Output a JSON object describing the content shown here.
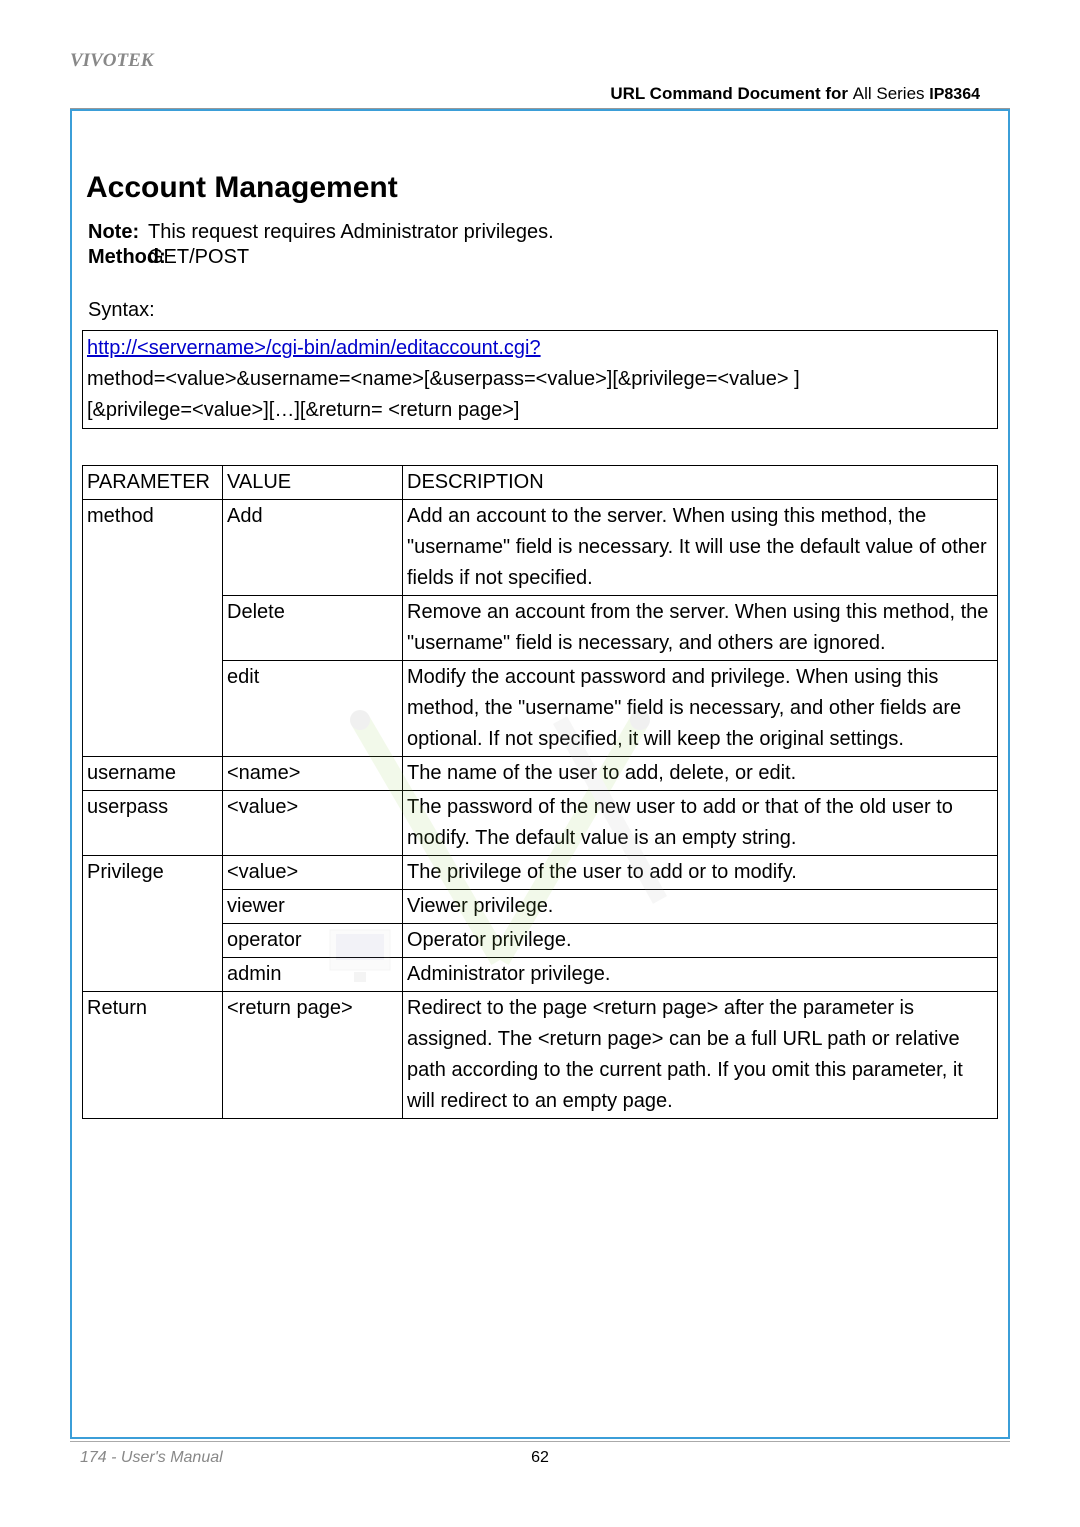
{
  "header": {
    "brand": "VIVOTEK",
    "doc_title_bold": "URL Command Document for ",
    "doc_title_series": "  All Series",
    "doc_title_model": "IP8364"
  },
  "section": {
    "heading": "Account  Management",
    "note_label": "Note:",
    "note_text": "This request requires Administrator privileges.",
    "method_label": "Method:",
    "method_text": "GET/POST",
    "syntax_label": "Syntax:"
  },
  "syntax": {
    "url": "http://<servername>/cgi-bin/admin/editaccount.cgi?",
    "line2": "method=<value>&username=<name>[&userpass=<value>][&privilege=<value>  ]",
    "line3": "[&privilege=<value>][…][&return=   <return page>]"
  },
  "table": {
    "head": {
      "c1": "PARAMETER",
      "c2": "VALUE",
      "c3": "DESCRIPTION"
    },
    "rows": [
      {
        "p": "method",
        "v": "Add",
        "d": "Add an account to the server. When using this method, the \"username\" field is necessary. It will use the default value of other fields if not specified."
      },
      {
        "p": "",
        "v": "Delete",
        "d": "Remove an account from the server. When using this method, the \"username\" field is necessary, and others are ignored."
      },
      {
        "p": "",
        "v": "edit",
        "d": "Modify the account password and privilege. When using this method, the \"username\" field is necessary, and other fields are optional. If not specified, it will keep the original settings."
      },
      {
        "p": "username",
        "v": "<name>",
        "d": "The name of the user to add, delete, or edit."
      },
      {
        "p": "userpass",
        "v": "<value>",
        "d": "The password of the new user to add or that of the old user to modify. The default value is an empty string."
      },
      {
        "p": "Privilege",
        "v": "<value>",
        "d": "The privilege of the user to add or to modify."
      },
      {
        "p": "",
        "v": "viewer",
        "d": "Viewer privilege."
      },
      {
        "p": "",
        "v": "operator",
        "d": "Operator privilege."
      },
      {
        "p": "",
        "v": "admin",
        "d": "Administrator privilege."
      },
      {
        "p": "Return",
        "v": "<return page>",
        "d": " Redirect to the page <return page> after the parameter is assigned. The <return page> can be a full URL path or relative path according to the current path. If you omit this parameter, it will redirect to an empty page."
      }
    ]
  },
  "footer": {
    "left": "174 - User's Manual",
    "page_num": "62"
  }
}
